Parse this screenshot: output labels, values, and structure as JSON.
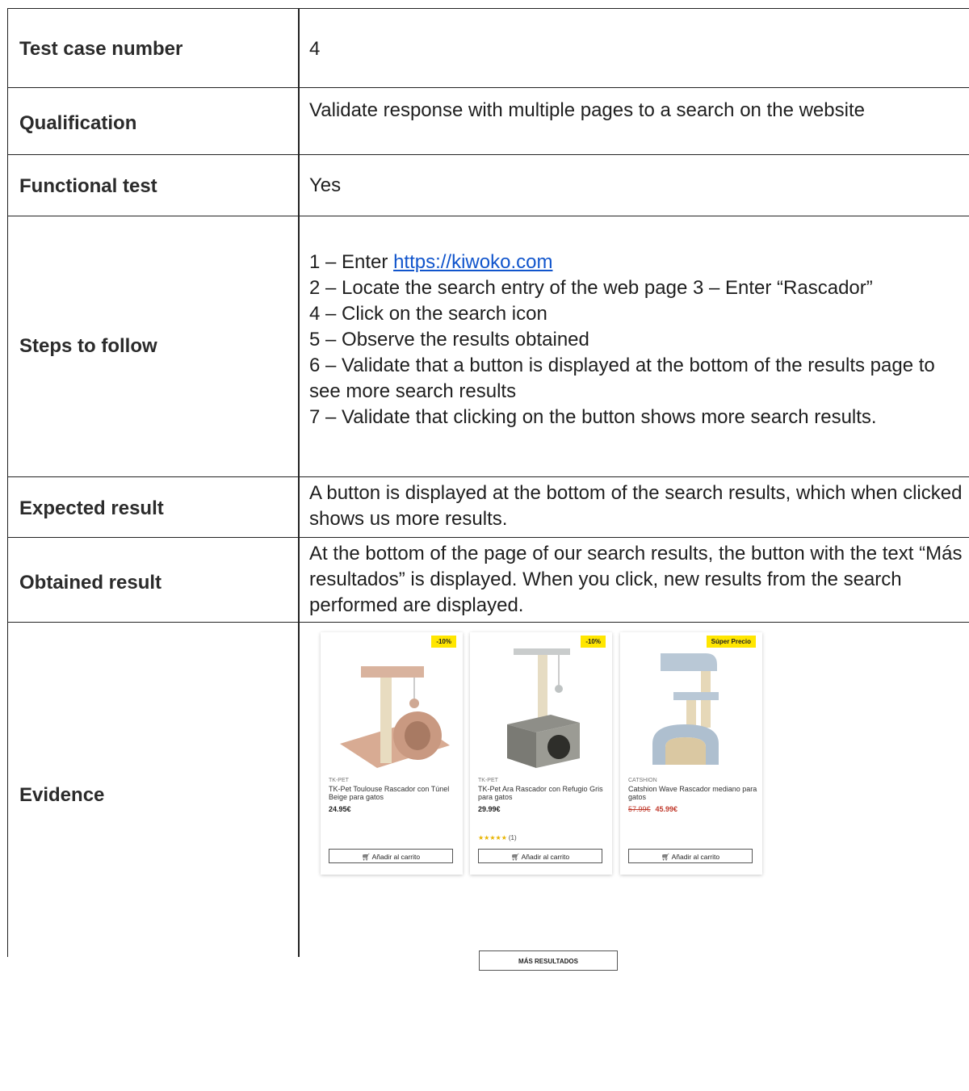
{
  "rows": [
    {
      "label": "Test case number",
      "value": "4"
    },
    {
      "label": "Qualification",
      "value": "Validate response with multiple pages to a search on the website"
    },
    {
      "label": "Functional test",
      "value": "Yes"
    },
    {
      "label": "Steps to follow"
    },
    {
      "label": "Expected result",
      "value": "A button is displayed at the bottom of the search results, which when clicked shows us more results."
    },
    {
      "label": "Obtained result",
      "value": "At the bottom of the page of our search results, the button with the text “Más resultados” is displayed. When you click, new results from the search performed are displayed."
    },
    {
      "label": "Evidence"
    }
  ],
  "steps": {
    "s1_prefix": "1 – Enter ",
    "s1_link": "https://kiwoko.com",
    "s2": "2 – Locate the search entry of the web page 3 – Enter “Rascador”",
    "s4": "4 – Click on the search icon",
    "s5": "5 – Observe the results obtained",
    "s6": "6 – Validate that a button is displayed at the bottom of the results page to see more search results",
    "s7": "7 – Validate that clicking on the button shows more search results."
  },
  "evidence": {
    "products": [
      {
        "badge": "-10%",
        "brand": "TK-PET",
        "name": "TK-Pet Toulouse Rascador con Túnel Beige para gatos",
        "price": "24.95€",
        "cart": "Añadir al carrito"
      },
      {
        "badge": "-10%",
        "brand": "TK-PET",
        "name": "TK-Pet Ara Rascador con Refugio Gris para gatos",
        "price": "29.99€",
        "stars": "★★★★★",
        "reviews": "(1)",
        "cart": "Añadir al carrito"
      },
      {
        "badge": "Súper Precio",
        "brand": "CATSHION",
        "name": "Catshion Wave Rascador mediano para gatos",
        "old_price": "57.99€",
        "price": "45.99€",
        "cart": "Añadir al carrito"
      }
    ],
    "more_button": "MÁS RESULTADOS"
  }
}
